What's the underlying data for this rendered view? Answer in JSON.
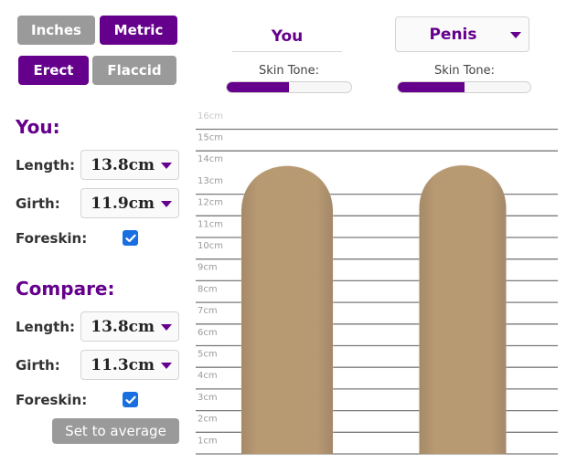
{
  "unit_toggle": {
    "options": [
      {
        "label": "Inches",
        "active": false
      },
      {
        "label": "Metric",
        "active": true
      }
    ]
  },
  "state_toggle": {
    "options": [
      {
        "label": "Erect",
        "active": true
      },
      {
        "label": "Flaccid",
        "active": false
      }
    ]
  },
  "columns": {
    "you": {
      "title": "You",
      "skin_tone_label": "Skin Tone:",
      "skin_tone_value": 0.5
    },
    "compare": {
      "selected": "Penis",
      "skin_tone_label": "Skin Tone:",
      "skin_tone_value": 0.5
    }
  },
  "you_panel": {
    "title": "You:",
    "length_label": "Length:",
    "length_value": "13.8cm",
    "girth_label": "Girth:",
    "girth_value": "11.9cm",
    "foreskin_label": "Foreskin:",
    "foreskin_checked": true
  },
  "compare_panel": {
    "title": "Compare:",
    "length_label": "Length:",
    "length_value": "13.8cm",
    "girth_label": "Girth:",
    "girth_value": "11.3cm",
    "foreskin_label": "Foreskin:",
    "foreskin_checked": true
  },
  "set_average_label": "Set to average",
  "colors": {
    "accent": "#65008c",
    "inactive": "#9a9a9a",
    "skin": "#b89a72",
    "checkbox": "#1a6fe0",
    "grid": "#7a7a7a"
  },
  "ruler": {
    "unit": "cm",
    "ticks": [
      "1cm",
      "2cm",
      "3cm",
      "4cm",
      "5cm",
      "6cm",
      "7cm",
      "8cm",
      "9cm",
      "10cm",
      "11cm",
      "12cm",
      "13cm",
      "14cm",
      "15cm",
      "16cm"
    ],
    "max": 16
  },
  "shapes": [
    {
      "name": "you",
      "length_cm": 13.8,
      "girth_cm": 11.9
    },
    {
      "name": "compare",
      "length_cm": 13.8,
      "girth_cm": 11.3
    }
  ]
}
